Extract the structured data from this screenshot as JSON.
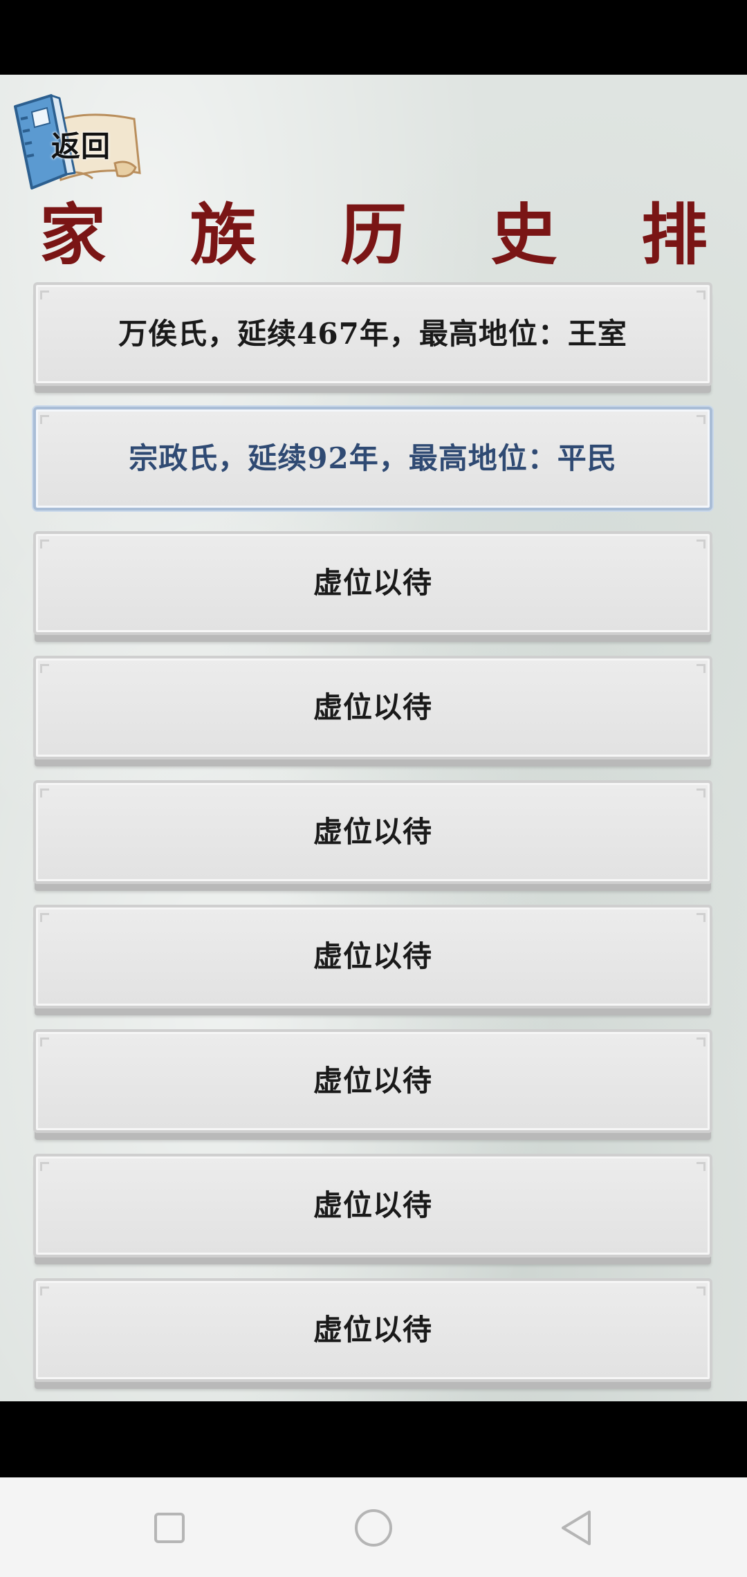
{
  "header": {
    "back_label": "返回",
    "title": "家 族 历 史 排 名"
  },
  "rankings": [
    {
      "text": "万俟氏，延续467年，最高地位：王室",
      "selected": false
    },
    {
      "text": "宗政氏，延续92年，最高地位：平民",
      "selected": true
    },
    {
      "text": "虚位以待",
      "selected": false
    },
    {
      "text": "虚位以待",
      "selected": false
    },
    {
      "text": "虚位以待",
      "selected": false
    },
    {
      "text": "虚位以待",
      "selected": false
    },
    {
      "text": "虚位以待",
      "selected": false
    },
    {
      "text": "虚位以待",
      "selected": false
    },
    {
      "text": "虚位以待",
      "selected": false
    }
  ],
  "nav": {
    "recent_icon": "square-icon",
    "home_icon": "circle-icon",
    "back_icon": "triangle-back-icon"
  },
  "colors": {
    "title": "#7a1515",
    "selected_text": "#2f4a73",
    "book_cover": "#5b9ad1"
  }
}
